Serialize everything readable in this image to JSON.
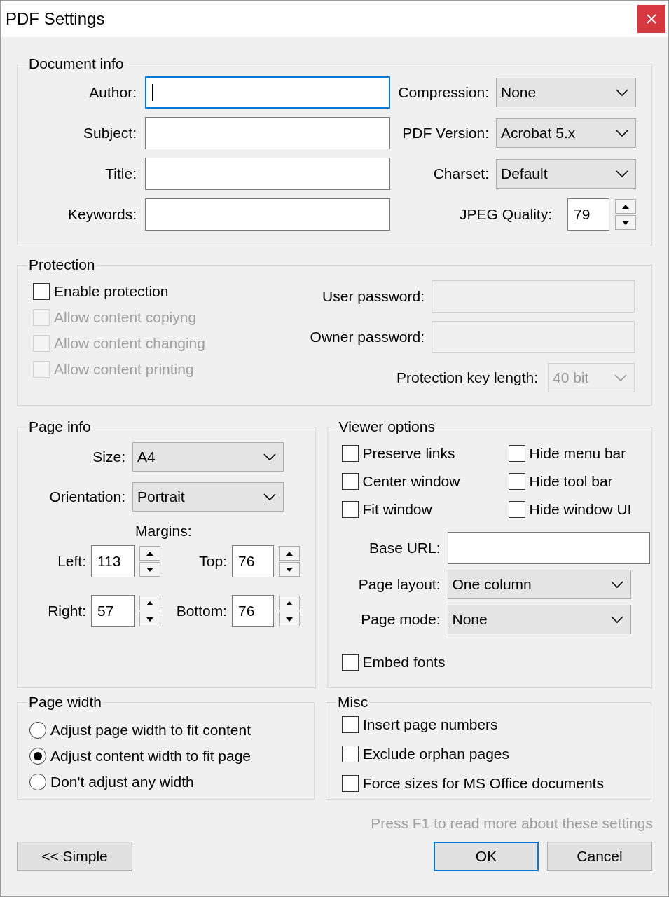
{
  "window": {
    "title": "PDF Settings"
  },
  "document_info": {
    "title": "Document info",
    "fields": [
      {
        "label": "Author:",
        "focused": true
      },
      {
        "label": "Subject:",
        "focused": false
      },
      {
        "label": "Title:",
        "focused": false
      },
      {
        "label": "Keywords:",
        "focused": false
      }
    ],
    "options": [
      {
        "label": "Compression:",
        "value": "None"
      },
      {
        "label": "PDF Version:",
        "value": "Acrobat 5.x"
      },
      {
        "label": "Charset:",
        "value": "Default"
      }
    ],
    "jpeg_quality": {
      "label": "JPEG Quality:",
      "value": "79"
    }
  },
  "protection": {
    "title": "Protection",
    "options": [
      {
        "label": "Enable protection",
        "checked": false,
        "disabled": false
      },
      {
        "label": "Allow content copiyng",
        "checked": false,
        "disabled": true
      },
      {
        "label": "Allow content changing",
        "checked": false,
        "disabled": true
      },
      {
        "label": "Allow content printing",
        "checked": false,
        "disabled": true
      }
    ],
    "passwords": [
      {
        "label": "User password:",
        "disabled": true
      },
      {
        "label": "Owner password:",
        "disabled": true
      }
    ],
    "key_length": {
      "label": "Protection key length:",
      "value": "40 bit",
      "disabled": true
    }
  },
  "page_info": {
    "title": "Page info",
    "options": [
      {
        "label": "Size:",
        "value": "A4"
      },
      {
        "label": "Orientation:",
        "value": "Portrait"
      }
    ],
    "margins_title": "Margins:",
    "margins": [
      {
        "label": "Left:",
        "value": "113"
      },
      {
        "label": "Top:",
        "value": "76"
      },
      {
        "label": "Right:",
        "value": "57"
      },
      {
        "label": "Bottom:",
        "value": "76"
      }
    ]
  },
  "viewer_options": {
    "title": "Viewer options",
    "options": [
      {
        "label": "Preserve links",
        "checked": false
      },
      {
        "label": "Hide menu bar",
        "checked": false
      },
      {
        "label": "Center window",
        "checked": false
      },
      {
        "label": "Hide tool bar",
        "checked": false
      },
      {
        "label": "Fit window",
        "checked": false
      },
      {
        "label": "Hide window UI",
        "checked": false
      }
    ],
    "base_url": {
      "label": "Base URL:"
    },
    "layout": [
      {
        "label": "Page layout:",
        "value": "One column"
      },
      {
        "label": "Page mode:",
        "value": "None"
      }
    ],
    "embed_fonts": {
      "label": "Embed fonts",
      "checked": false
    }
  },
  "page_width": {
    "title": "Page width",
    "options": [
      {
        "label": "Adjust page width to fit content",
        "selected": false
      },
      {
        "label": "Adjust content width to fit page",
        "selected": true
      },
      {
        "label": "Don't adjust any width",
        "selected": false
      }
    ]
  },
  "misc": {
    "title": "Misc",
    "options": [
      {
        "label": "Insert page numbers",
        "checked": false
      },
      {
        "label": "Exclude orphan pages",
        "checked": false
      },
      {
        "label": "Force sizes for MS Office documents",
        "checked": false
      }
    ]
  },
  "hint": "Press F1 to read more about these settings",
  "buttons": [
    {
      "label": "<< Simple",
      "default": false
    },
    {
      "label": "OK",
      "default": true
    },
    {
      "label": "Cancel",
      "default": false
    }
  ]
}
